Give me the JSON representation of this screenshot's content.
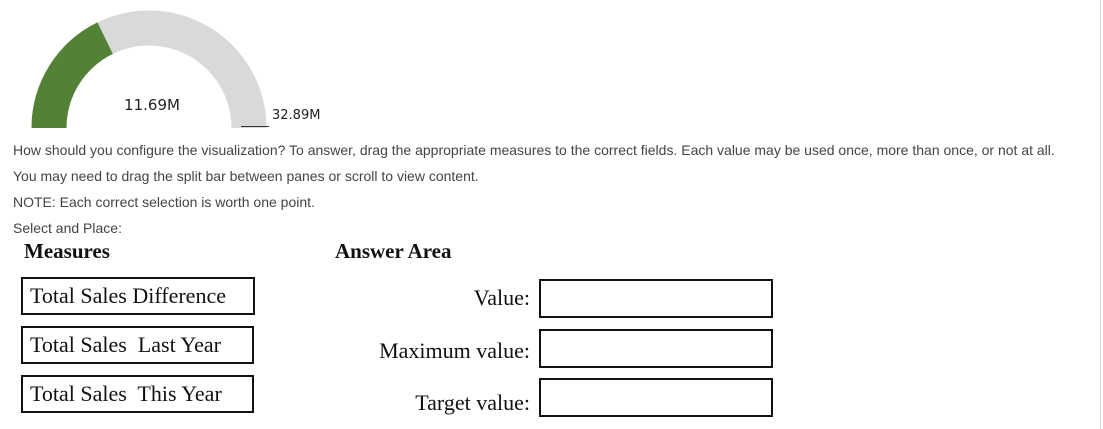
{
  "gauge": {
    "value_label": "11.69M",
    "max_label": "32.89M",
    "value": 11.69,
    "max": 32.89,
    "fill_color": "#538135",
    "track_color": "#d9d9d9"
  },
  "instructions": {
    "line1": "How should you configure the visualization? To answer, drag the appropriate measures to the correct fields. Each value may be used once, more than once, or not at all.",
    "line2": "You may need to drag the split bar between panes or scroll to view content.",
    "line3": "NOTE: Each correct selection is worth one point.",
    "line4": "Select and Place:"
  },
  "measures": {
    "heading": "Measures",
    "items": [
      {
        "label": "Total Sales Difference"
      },
      {
        "label": "Total Sales  Last Year"
      },
      {
        "label": "Total Sales  This Year"
      }
    ]
  },
  "answer_area": {
    "heading": "Answer Area",
    "fields": [
      {
        "label": "Value:"
      },
      {
        "label": "Maximum value:"
      },
      {
        "label": "Target value:"
      }
    ]
  }
}
